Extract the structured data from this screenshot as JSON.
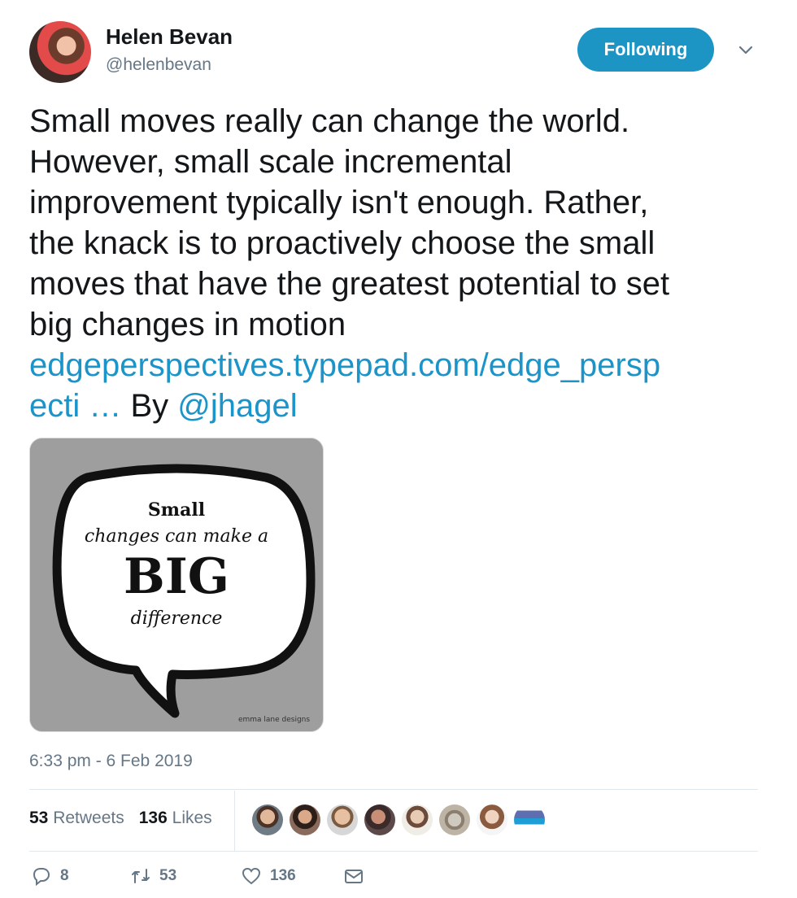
{
  "author": {
    "name": "Helen Bevan",
    "handle": "@helenbevan"
  },
  "follow_button": {
    "label": "Following"
  },
  "tweet": {
    "text_lines": [
      "Small moves really can change the world.",
      "However, small scale incremental",
      "improvement typically isn't enough. Rather,",
      "the knack is to proactively choose the small",
      "moves that have the greatest potential to set",
      "big changes in motion"
    ],
    "link_line1": "edgeperspectives.typepad.com/edge_persp",
    "link_line2": "ecti …",
    "by_text": "By",
    "mention": "@jhagel"
  },
  "media": {
    "line1": "Small",
    "line2": "changes can make a",
    "line3": "BIG",
    "line4": "difference",
    "credit": "emma lane designs"
  },
  "timestamp": "6:33 pm - 6 Feb 2019",
  "stats": {
    "retweets_count": "53",
    "retweets_label": "Retweets",
    "likes_count": "136",
    "likes_label": "Likes"
  },
  "actions": {
    "reply_count": "8",
    "retweet_count": "53",
    "like_count": "136"
  },
  "colors": {
    "accent": "#1c94c4",
    "link": "#1b95c9",
    "muted": "#657786"
  }
}
